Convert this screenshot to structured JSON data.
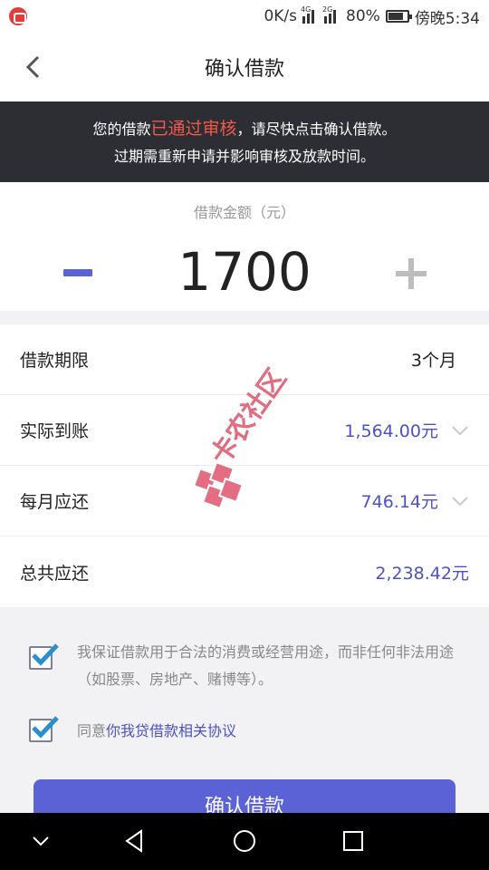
{
  "status_bar": {
    "speed": "0K/s",
    "network_4g": "4G",
    "network_2g": "2G",
    "battery": "80%",
    "time": "傍晚5:34"
  },
  "nav": {
    "title": "确认借款",
    "back_icon": "chevron-left-icon"
  },
  "notice": {
    "line1_prefix": "您的借款",
    "line1_highlight": "已通过审核",
    "line1_suffix": "，请尽快点击确认借款。",
    "line2": "过期需重新申请并影响审核及放款时间。",
    "highlight_color": "#f05a4a"
  },
  "amount": {
    "label": "借款金额（元）",
    "value": "1700"
  },
  "rows": [
    {
      "label": "借款期限",
      "value": "3个月"
    },
    {
      "label": "实际到账",
      "value": "1,564.00元"
    },
    {
      "label": "每月应还",
      "value": "746.14元"
    },
    {
      "label": "总共应还",
      "value": "2,238.42元"
    }
  ],
  "agreements": {
    "guarantee_text": "我保证借款用于合法的消费或经营用途，而非任何非法用途（如股票、房地产、赌博等）。",
    "consent_prefix": "同意",
    "consent_link": "你我贷借款相关协议"
  },
  "confirm_button": "确认借款",
  "watermark": "卡农社区",
  "colors": {
    "accent": "#5b62d6",
    "dark_banner": "#2d2e33",
    "blue_text": "#4b52c4"
  }
}
